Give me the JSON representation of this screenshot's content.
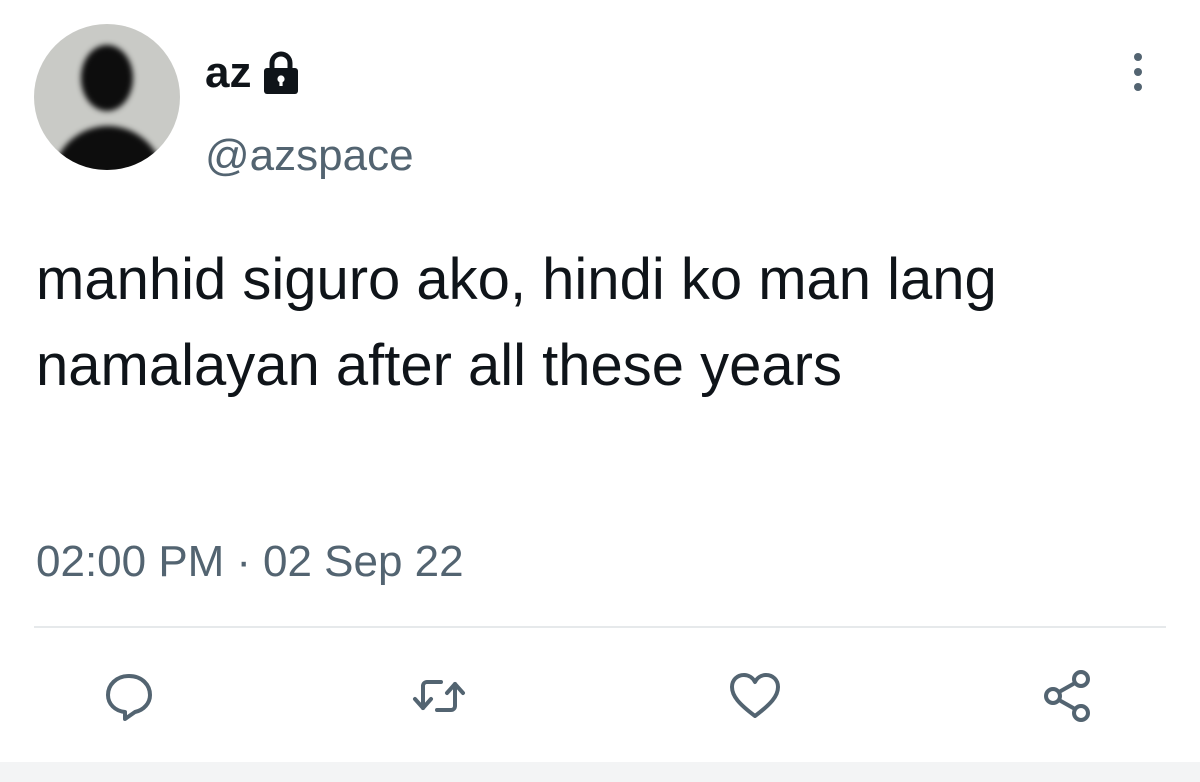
{
  "tweet": {
    "display_name": "az",
    "handle": "@azspace",
    "text": "manhid siguro ako, hindi ko man lang namalayan after all these years",
    "time": "02:00 PM",
    "separator": "·",
    "date": "02 Sep 22",
    "protected": true
  },
  "icons": {
    "lock": "lock-icon",
    "more": "more-vertical-icon",
    "reply": "reply-icon",
    "retweet": "retweet-icon",
    "like": "heart-icon",
    "share": "share-icon"
  },
  "colors": {
    "text_primary": "#0f1419",
    "text_secondary": "#536471",
    "icon": "#536471",
    "divider": "#e6e9eb",
    "avatar_bg": "#c9cac6"
  }
}
